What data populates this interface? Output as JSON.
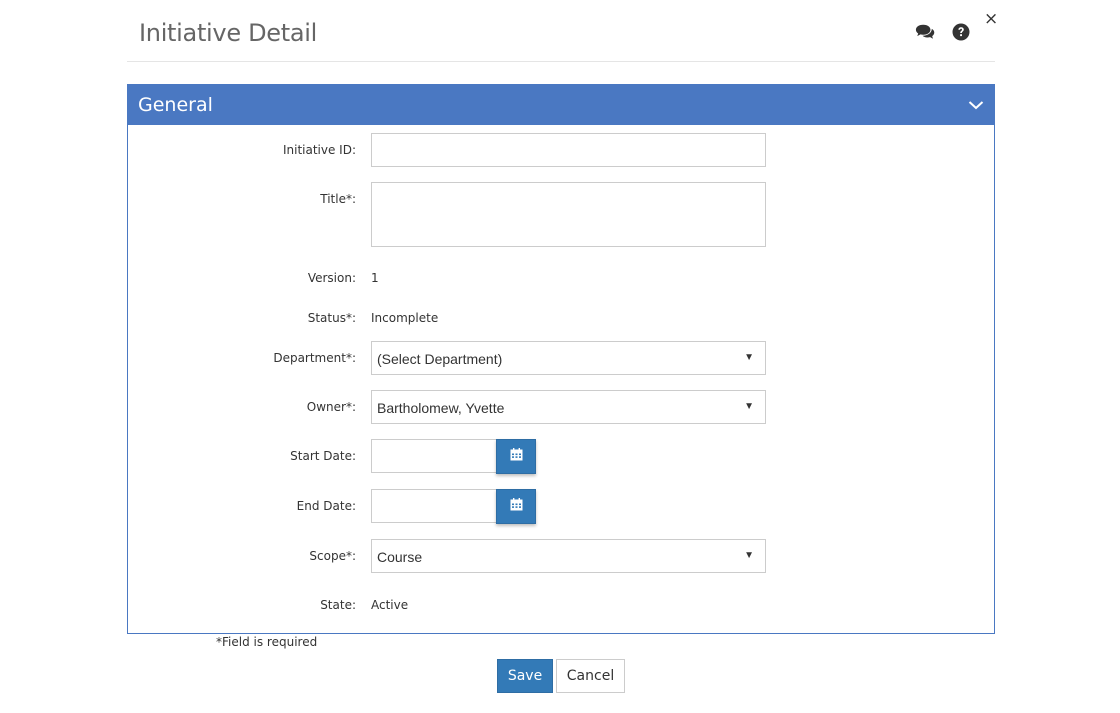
{
  "header": {
    "title": "Initiative Detail",
    "close_label": "×"
  },
  "icons": {
    "chat": "comments-icon",
    "help": "question-circle-icon",
    "calendar": "calendar-icon",
    "collapse": "chevron-down-icon"
  },
  "colors": {
    "panel_header": "#4a78c2",
    "primary_button": "#337ab7"
  },
  "section": {
    "title": "General"
  },
  "form": {
    "initiative_id": {
      "label": "Initiative ID:",
      "value": ""
    },
    "title": {
      "label": "Title*:",
      "value": ""
    },
    "version": {
      "label": "Version:",
      "value": "1"
    },
    "status": {
      "label": "Status*:",
      "value": "Incomplete"
    },
    "department": {
      "label": "Department*:",
      "selected": "(Select Department)"
    },
    "owner": {
      "label": "Owner*:",
      "selected": "Bartholomew, Yvette"
    },
    "start_date": {
      "label": "Start Date:",
      "value": ""
    },
    "end_date": {
      "label": "End Date:",
      "value": ""
    },
    "scope": {
      "label": "Scope*:",
      "selected": "Course"
    },
    "state": {
      "label": "State:",
      "value": "Active"
    }
  },
  "footer": {
    "required_note": "*Field is required",
    "save_label": "Save",
    "cancel_label": "Cancel"
  }
}
